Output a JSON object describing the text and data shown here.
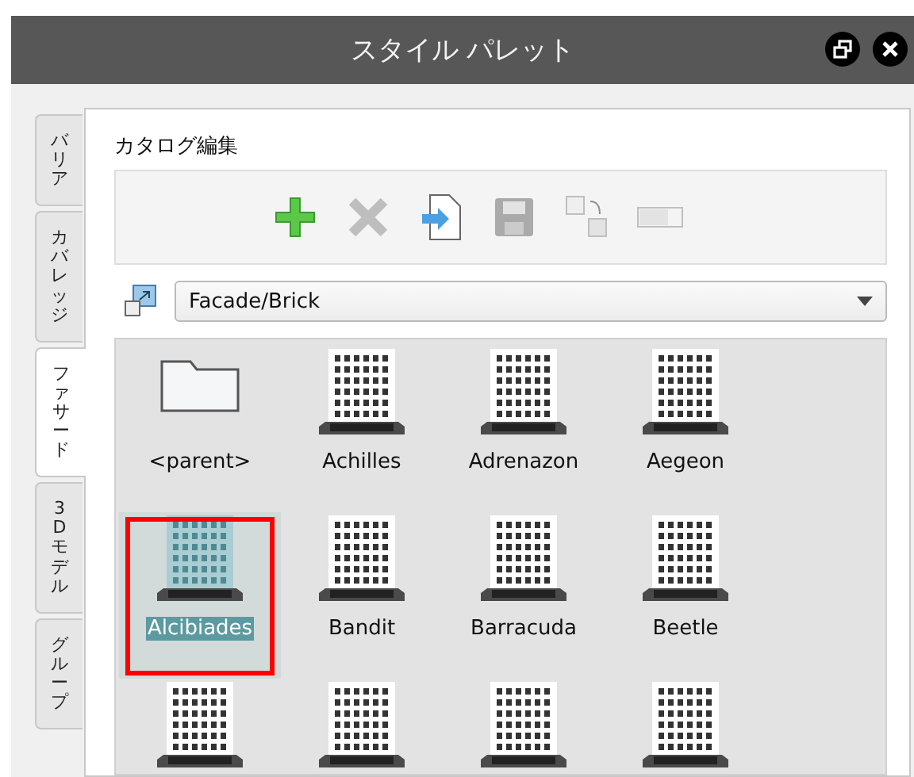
{
  "window": {
    "title": "スタイル パレット"
  },
  "side_tabs": [
    {
      "label": "バリア",
      "selected": false
    },
    {
      "label": "カバレッジ",
      "selected": false
    },
    {
      "label": "ファサード",
      "selected": true
    },
    {
      "label": "3D モデル",
      "selected": false
    },
    {
      "label": "グループ",
      "selected": false
    }
  ],
  "catalog": {
    "title": "カタログ編集",
    "tools": [
      {
        "kind": "add",
        "disabled": false
      },
      {
        "kind": "delete",
        "disabled": true
      },
      {
        "kind": "import",
        "disabled": false
      },
      {
        "kind": "save",
        "disabled": true
      },
      {
        "kind": "copy",
        "disabled": true
      },
      {
        "kind": "rename",
        "disabled": true
      }
    ]
  },
  "path_select": {
    "value": "Facade/Brick"
  },
  "items": [
    {
      "kind": "folder",
      "label": "<parent>",
      "selected": false,
      "highlighted": false
    },
    {
      "kind": "building",
      "label": "Achilles",
      "selected": false,
      "highlighted": false
    },
    {
      "kind": "building",
      "label": "Adrenazon",
      "selected": false,
      "highlighted": false
    },
    {
      "kind": "building",
      "label": "Aegeon",
      "selected": false,
      "highlighted": false
    },
    {
      "kind": "building",
      "label": "Alcibiades",
      "selected": true,
      "highlighted": true
    },
    {
      "kind": "building",
      "label": "Bandit",
      "selected": false,
      "highlighted": false
    },
    {
      "kind": "building",
      "label": "Barracuda",
      "selected": false,
      "highlighted": false
    },
    {
      "kind": "building",
      "label": "Beetle",
      "selected": false,
      "highlighted": false
    },
    {
      "kind": "building",
      "selected": false,
      "highlighted": false
    },
    {
      "kind": "building",
      "selected": false,
      "highlighted": false
    },
    {
      "kind": "building",
      "selected": false,
      "highlighted": false
    },
    {
      "kind": "building",
      "selected": false,
      "highlighted": false
    }
  ]
}
